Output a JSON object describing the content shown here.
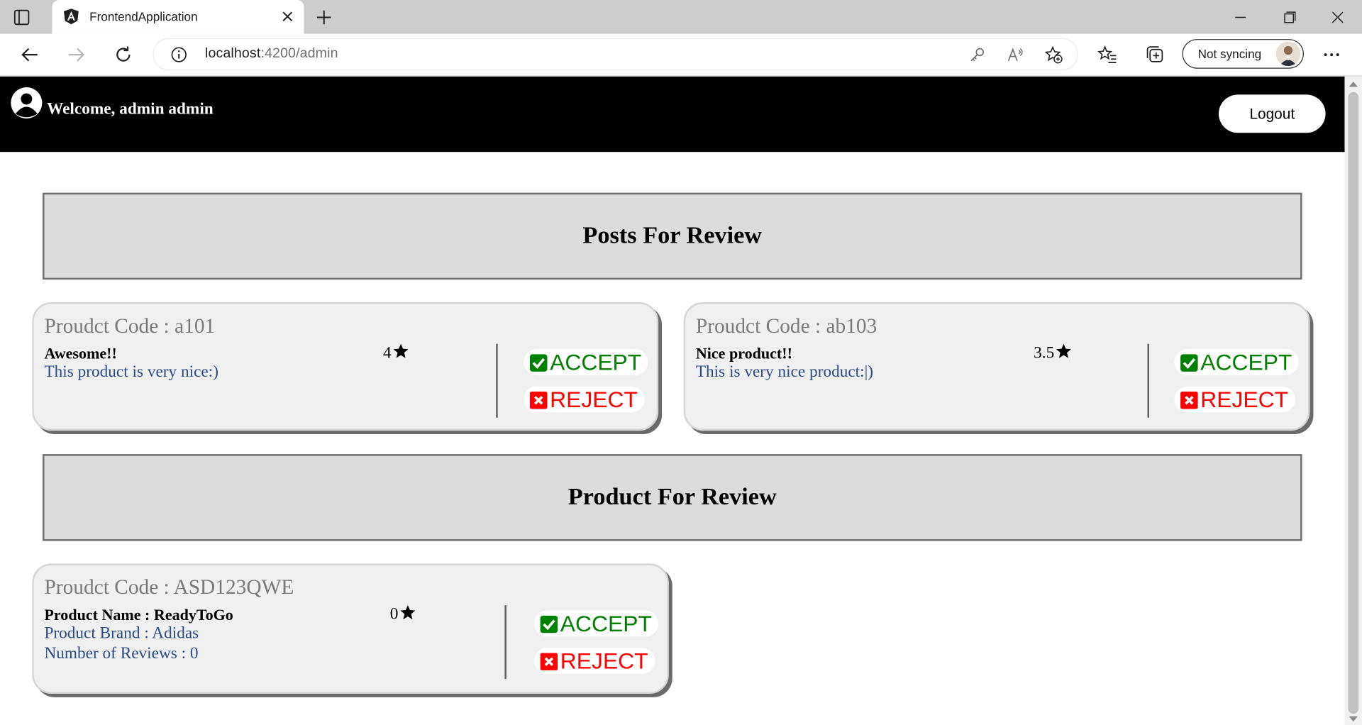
{
  "browser": {
    "tab_title": "FrontendApplication",
    "url_host": "localhost",
    "url_path": ":4200/admin",
    "sync_label": "Not syncing"
  },
  "header": {
    "welcome": "Welcome, admin admin",
    "logout_label": "Logout"
  },
  "posts_section": {
    "title": "Posts For Review",
    "items": [
      {
        "code": "Proudct Code : a101",
        "title": "Awesome!!",
        "body": "This product is very nice:)",
        "rating": "4"
      },
      {
        "code": "Proudct Code : ab103",
        "title": "Nice product!!",
        "body": "This is very nice product:|)",
        "rating": "3.5"
      }
    ]
  },
  "products_section": {
    "title": "Product For Review",
    "items": [
      {
        "code": "Proudct Code : ASD123QWE",
        "name": "Product Name : ReadyToGo",
        "brand": "Product Brand : Adidas",
        "reviews": "Number of Reviews : 0",
        "rating": "0"
      }
    ]
  },
  "actions": {
    "accept_label": "ACCEPT",
    "reject_label": "REJECT"
  },
  "colors": {
    "header_bg": "#000000",
    "accept": "#008000",
    "reject": "#ff0000",
    "section_bg": "#dcdcdc",
    "card_bg": "#f0f0f0",
    "body_text": "#2b4a8a"
  }
}
